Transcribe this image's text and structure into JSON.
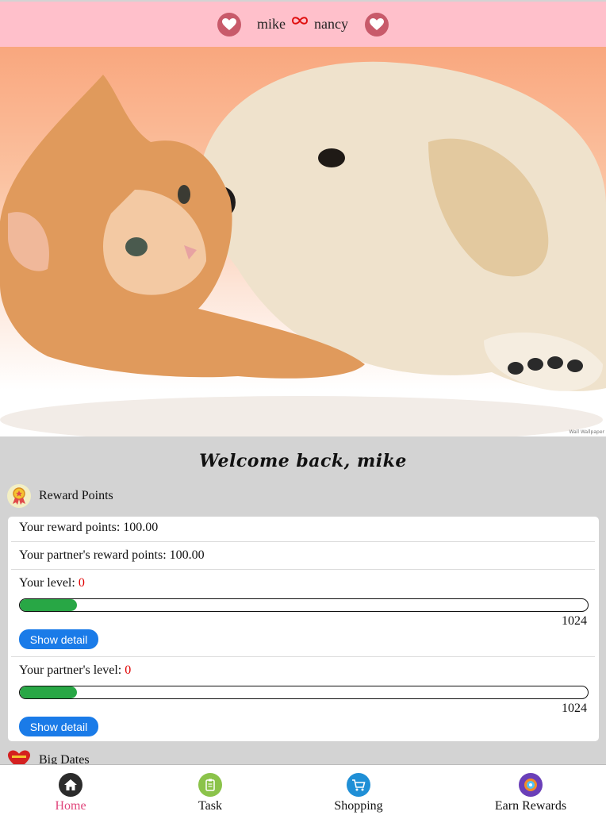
{
  "header": {
    "user_name": "mike",
    "partner_name": "nancy"
  },
  "hero": {
    "watermark": "Wall Wallpaper"
  },
  "welcome": "Welcome back, mike",
  "reward": {
    "section_title": "Reward Points",
    "my_points_label": "Your reward points: 100.00",
    "partner_points_label": "Your partner's reward points: 100.00",
    "my_level_label": "Your level: ",
    "my_level_value": "0",
    "my_level_progress_pct": 10,
    "my_level_max": "1024",
    "partner_level_label": "Your partner's level: ",
    "partner_level_value": "0",
    "partner_level_progress_pct": 10,
    "partner_level_max": "1024",
    "show_detail_label": "Show detail"
  },
  "big_dates": {
    "section_title": "Big Dates"
  },
  "nav": {
    "items": [
      {
        "label": "Home",
        "icon": "home-icon",
        "active": true
      },
      {
        "label": "Task",
        "icon": "clipboard-icon",
        "active": false
      },
      {
        "label": "Shopping",
        "icon": "cart-icon",
        "active": false
      },
      {
        "label": "Earn Rewards",
        "icon": "rewards-icon",
        "active": false
      }
    ]
  },
  "colors": {
    "header_bg": "#ffc0cb",
    "progress_fill": "#28a745",
    "button_blue": "#1a7be8",
    "active_nav": "#e0457b",
    "level_value": "#e00000"
  }
}
